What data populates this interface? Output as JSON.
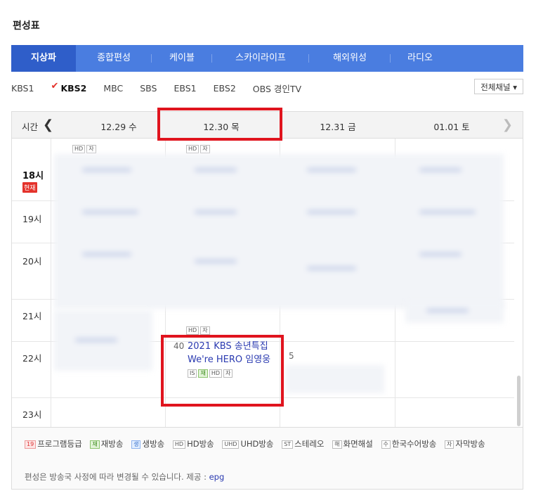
{
  "page_title": "편성표",
  "main_tabs": [
    {
      "label": "지상파",
      "active": true
    },
    {
      "label": "종합편성",
      "active": false
    },
    {
      "label": "케이블",
      "active": false
    },
    {
      "label": "스카이라이프",
      "active": false
    },
    {
      "label": "해외위성",
      "active": false
    },
    {
      "label": "라디오",
      "active": false
    }
  ],
  "channels": [
    {
      "label": "KBS1",
      "active": false
    },
    {
      "label": "KBS2",
      "active": true
    },
    {
      "label": "MBC",
      "active": false
    },
    {
      "label": "SBS",
      "active": false
    },
    {
      "label": "EBS1",
      "active": false
    },
    {
      "label": "EBS2",
      "active": false
    },
    {
      "label": "OBS 경인TV",
      "active": false
    }
  ],
  "channel_check_icon": "✔",
  "channel_dropdown": "전체채널 ▾",
  "schedule": {
    "time_label": "시간",
    "prev_icon": "❮",
    "next_icon": "❯",
    "dates": [
      "12.29 수",
      "12.30 목",
      "12.31 금",
      "01.01 토"
    ],
    "hours": [
      "18시",
      "19시",
      "20시",
      "21시",
      "22시",
      "23시"
    ],
    "now_badge": "현재",
    "tags": {
      "hd": "HD",
      "ja": "자",
      "is": "IS",
      "jae": "재"
    },
    "program": {
      "time": "40",
      "title": "2021 KBS 송년특집 We're HERO 임영웅"
    },
    "overflow_number": "5"
  },
  "legend": {
    "items": [
      {
        "badge": "19",
        "label": "프로그램등급",
        "style": "red"
      },
      {
        "badge": "재",
        "label": "재방송",
        "style": "green"
      },
      {
        "badge": "생",
        "label": "생방송",
        "style": "blue"
      },
      {
        "badge": "HD",
        "label": "HD방송",
        "style": "plain"
      },
      {
        "badge": "UHD",
        "label": "UHD방송",
        "style": "plain"
      },
      {
        "badge": "ST",
        "label": "스테레오",
        "style": "plain"
      },
      {
        "badge": "해",
        "label": "화면해설",
        "style": "plain"
      },
      {
        "badge": "수",
        "label": "한국수어방송",
        "style": "plain"
      },
      {
        "badge": "자",
        "label": "자막방송",
        "style": "plain"
      }
    ],
    "note": "편성은 방송국 사정에 따라 변경될 수 있습니다. 제공 : ",
    "provider": "epg"
  },
  "colors": {
    "tab_bg": "#4a7de0",
    "tab_active": "#2f5ec9",
    "highlight": "#e0141e",
    "link": "#2a3ab0"
  }
}
